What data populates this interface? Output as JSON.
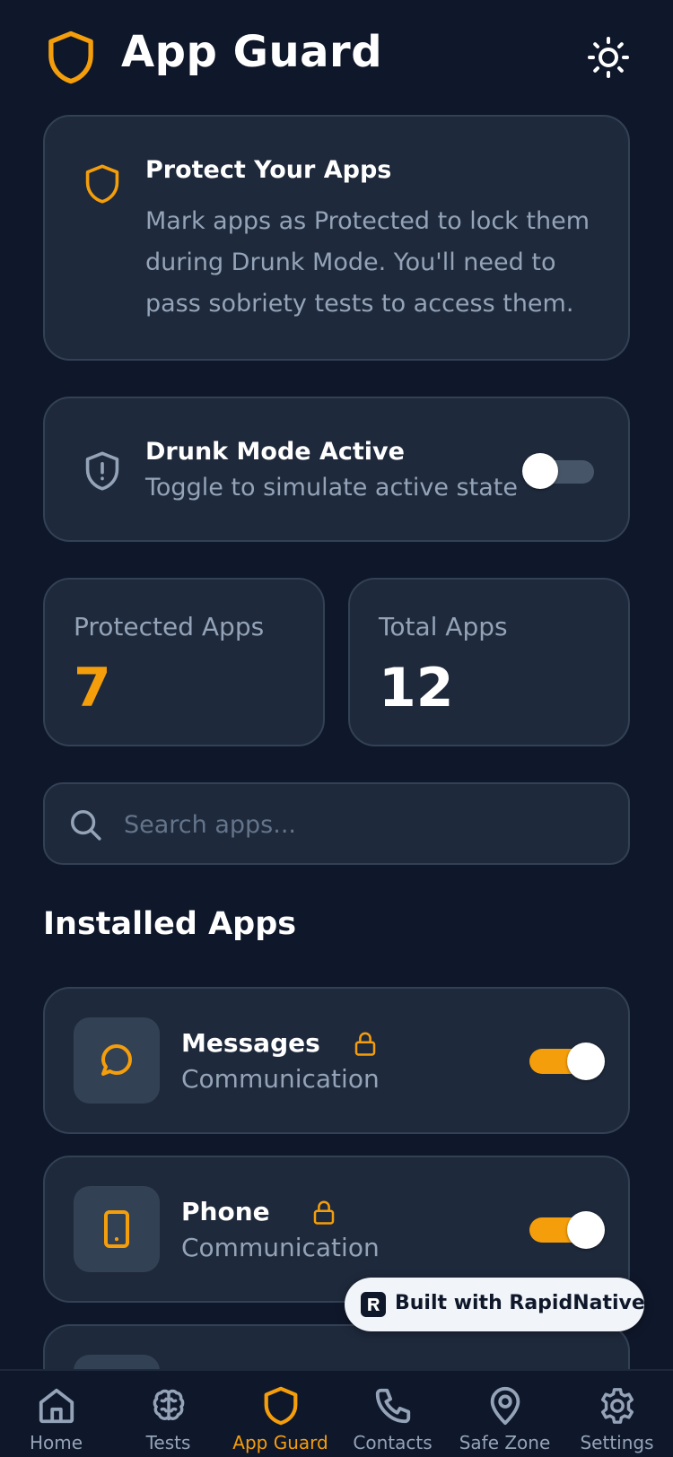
{
  "header": {
    "title": "App Guard",
    "logo_icon": "shield-icon",
    "theme_icon": "sun-icon"
  },
  "info_card": {
    "title": "Protect Your Apps",
    "lines": [
      "Mark apps as Protected to lock them",
      "during Drunk Mode. You'll need to",
      "pass sobriety tests to access them."
    ]
  },
  "drunk_mode": {
    "title": "Drunk Mode Active",
    "subtitle": "Toggle to simulate active state",
    "enabled": false
  },
  "stats": {
    "protected": {
      "label": "Protected Apps",
      "value": "7"
    },
    "total": {
      "label": "Total Apps",
      "value": "12"
    }
  },
  "search": {
    "placeholder": "Search apps...",
    "value": ""
  },
  "section_title": "Installed Apps",
  "apps": [
    {
      "name": "Messages",
      "category": "Communication",
      "icon": "message-circle-icon",
      "protected": true,
      "locked": true
    },
    {
      "name": "Phone",
      "category": "Communication",
      "icon": "smartphone-icon",
      "protected": true,
      "locked": true
    }
  ],
  "badge": {
    "text": "Built with RapidNative"
  },
  "bottom_nav": [
    {
      "label": "Home",
      "icon": "home-icon",
      "active": false
    },
    {
      "label": "Tests",
      "icon": "brain-icon",
      "active": false
    },
    {
      "label": "App Guard",
      "icon": "shield-icon",
      "active": true
    },
    {
      "label": "Contacts",
      "icon": "phone-icon",
      "active": false
    },
    {
      "label": "Safe Zone",
      "icon": "map-pin-icon",
      "active": false
    },
    {
      "label": "Settings",
      "icon": "gear-icon",
      "active": false
    }
  ],
  "colors": {
    "background": "#0f172a",
    "card": "#1e293b",
    "accent": "#f59e0b",
    "muted_text": "#94a3b8"
  }
}
